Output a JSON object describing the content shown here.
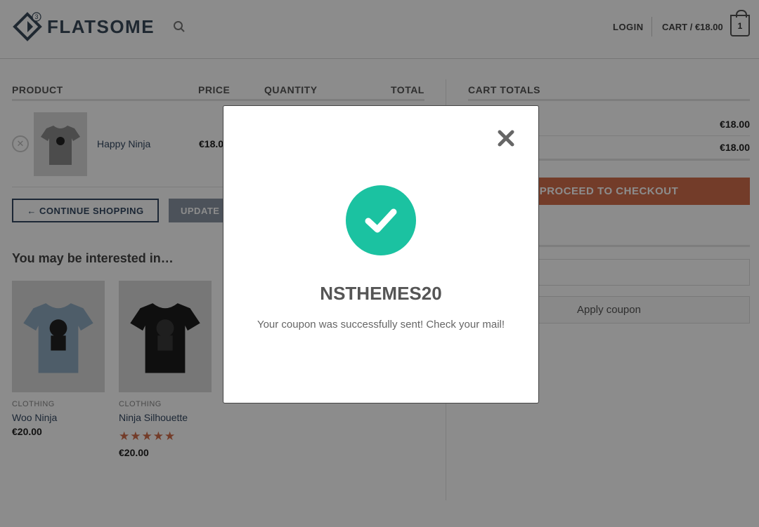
{
  "header": {
    "logo_text": "FLATSOME",
    "logo_badge": "3",
    "login_label": "LOGIN",
    "cart_label": "CART / €18.00",
    "cart_count": "1"
  },
  "cart_table": {
    "headers": [
      "PRODUCT",
      "PRICE",
      "QUANTITY",
      "TOTAL"
    ],
    "item": {
      "name": "Happy Ninja",
      "price": "€18.0"
    },
    "continue_label": "← CONTINUE SHOPPING",
    "update_label": "UPDATE"
  },
  "related": {
    "title": "You may be interested in…",
    "products": [
      {
        "category": "CLOTHING",
        "name": "Woo Ninja",
        "price": "€20.00",
        "color": "#8fa9bf"
      },
      {
        "category": "CLOTHING",
        "name": "Ninja Silhouette",
        "price": "€20.00",
        "color": "#1d1d1d",
        "rating": 5,
        "stars": "★★★★★"
      }
    ]
  },
  "cart_totals": {
    "title": "CART TOTALS",
    "subtotal": "€18.00",
    "total": "€18.00",
    "checkout_label": "PROCEED TO CHECKOUT",
    "apply_coupon_label": "Apply coupon"
  },
  "modal": {
    "coupon_code": "NSTHEMES20",
    "message": "Your coupon was successfully sent! Check your mail!",
    "success_color": "#1bc2a1",
    "close_icon": "close-icon"
  },
  "colors": {
    "accent": "#d26e4b",
    "primary": "#334862"
  }
}
